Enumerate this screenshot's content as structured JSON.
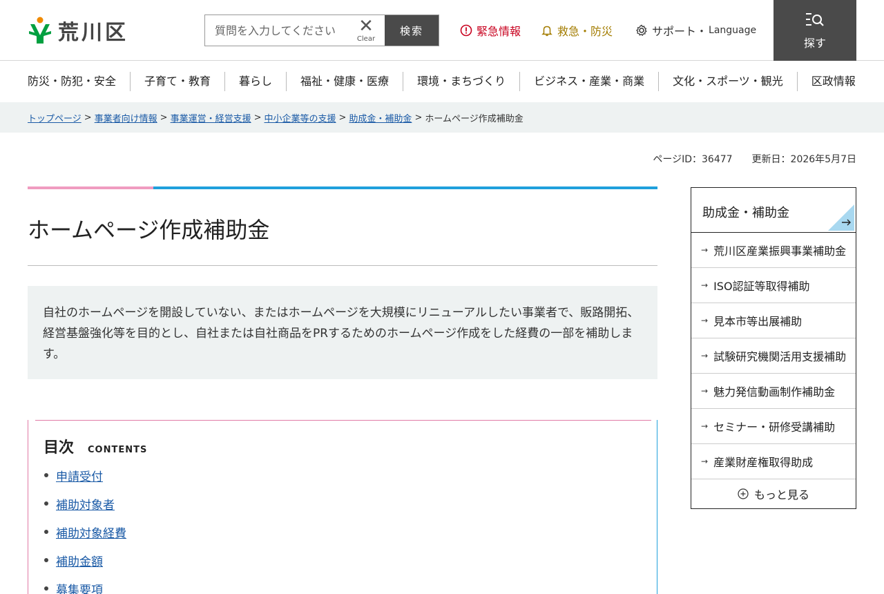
{
  "header": {
    "logo_text": "荒川区",
    "search_placeholder": "質問を入力してください",
    "clear_label": "Clear",
    "search_button": "検索",
    "emergency_label": "緊急情報",
    "disaster_label": "救急・防災",
    "support_label": "サポート・",
    "language_label": "Language",
    "menu_label": "探す",
    "colors": {
      "emergency": "#c8001e",
      "disaster": "#a37c00",
      "menu_bg": "#4a4a4a",
      "logo_green": "#00a040",
      "logo_orange": "#f08a00"
    }
  },
  "gnav": [
    "防災・防犯・安全",
    "子育て・教育",
    "暮らし",
    "福祉・健康・医療",
    "環境・まちづくり",
    "ビジネス・産業・商業",
    "文化・スポーツ・観光",
    "区政情報"
  ],
  "breadcrumb": {
    "links": [
      "トップページ",
      "事業者向け情報",
      "事業運営・経営支援",
      "中小企業等の支援",
      "助成金・補助金"
    ],
    "separator": ">",
    "current": "ホームページ作成補助金"
  },
  "meta": {
    "page_id": "ページID：36477",
    "updated": "更新日：2026年5月7日"
  },
  "main": {
    "title": "ホームページ作成補助金",
    "lead": "自社のホームページを開設していない、またはホームページを大規模にリニューアルしたい事業者で、販路開拓、経営基盤強化等を目的とし、自社または自社商品をPRするためのホームページ作成をした経費の一部を補助します。",
    "toc": {
      "title": "目次",
      "subtitle": "CONTENTS",
      "items": [
        "申請受付",
        "補助対象者",
        "補助対象経費",
        "補助金額",
        "募集要項"
      ]
    },
    "accent_colors": {
      "pink": "#f09cc0",
      "blue": "#1fa0dc"
    }
  },
  "sidebar": {
    "title": "助成金・補助金",
    "items": [
      "荒川区産業振興事業補助金",
      "ISO認証等取得補助",
      "見本市等出展補助",
      "試験研究機関活用支援補助",
      "魅力発信動画制作補助金",
      "セミナー・研修受講補助",
      "産業財産権取得助成"
    ],
    "more_label": "もっと見る",
    "icons": {
      "item": "arrow-right-icon",
      "more": "plus-circle-icon",
      "corner": "arrow-corner-icon"
    }
  }
}
